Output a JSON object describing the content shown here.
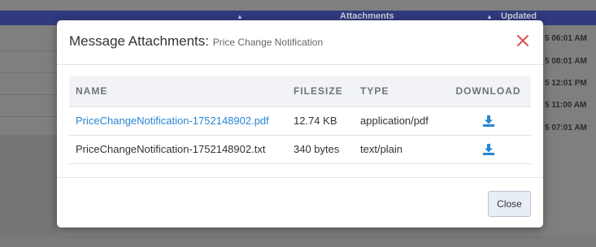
{
  "background": {
    "header": {
      "attachments_label": "Attachments",
      "updated_label": "Updated"
    },
    "times": [
      "5 06:01 AM",
      "5 08:01 AM",
      "5 12:01 PM",
      "5 11:00 AM",
      "5 07:01 AM"
    ]
  },
  "modal": {
    "title": "Message Attachments:",
    "subtitle": "Price Change Notification",
    "close_icon": "close-icon",
    "table": {
      "headers": {
        "name": "NAME",
        "filesize": "FILESIZE",
        "type": "TYPE",
        "download": "DOWNLOAD"
      },
      "rows": [
        {
          "name": "PriceChangeNotification-1752148902.pdf",
          "filesize": "12.74 KB",
          "type": "application/pdf",
          "download_icon": "download-icon"
        },
        {
          "name": "PriceChangeNotification-1752148902.txt",
          "filesize": "340 bytes",
          "type": "text/plain",
          "download_icon": "download-icon"
        }
      ]
    },
    "footer": {
      "close_label": "Close"
    }
  },
  "colors": {
    "link": "#2a85d4",
    "close_x": "#d9534f",
    "header_bg": "#303a7d"
  }
}
